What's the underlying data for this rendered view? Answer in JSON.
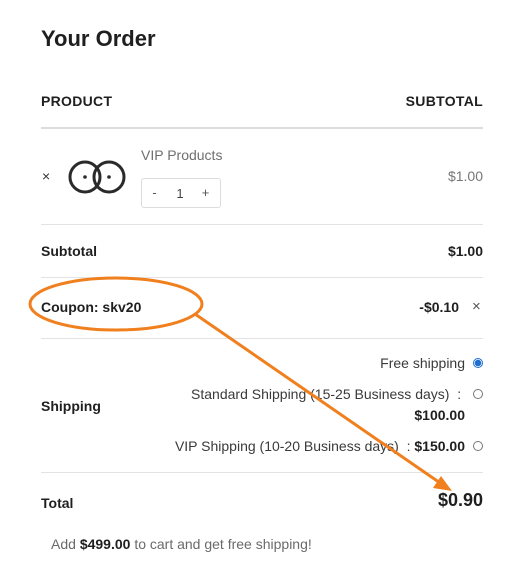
{
  "order": {
    "title": "Your Order"
  },
  "table": {
    "product_header": "PRODUCT",
    "subtotal_header": "SUBTOTAL"
  },
  "item": {
    "remove_glyph": "×",
    "name": "VIP Products",
    "quantity": "1",
    "minus": "-",
    "plus": "+",
    "price": "$1.00",
    "thumbnail_icon": "bicycle-wheels-icon"
  },
  "subtotal": {
    "label": "Subtotal",
    "value": "$1.00"
  },
  "coupon": {
    "label": "Coupon: skv20",
    "value": "-$0.10",
    "remove_glyph": "×"
  },
  "shipping": {
    "label": "Shipping",
    "options": [
      {
        "name": "Free shipping",
        "price": "",
        "selected": true
      },
      {
        "name": "Standard Shipping  (15-25 Business days)",
        "price": "$100.00",
        "selected": false
      },
      {
        "name": "VIP Shipping  (10-20 Business days)",
        "price": "$150.00",
        "selected": false
      }
    ]
  },
  "total": {
    "label": "Total",
    "value": "$0.90"
  },
  "free_shipping_note": {
    "prefix": "Add",
    "amount": "$499.00",
    "suffix": "to cart and get free shipping!"
  },
  "annotation": {
    "color": "#f07f1e",
    "shape": "ellipse-with-arrow"
  }
}
